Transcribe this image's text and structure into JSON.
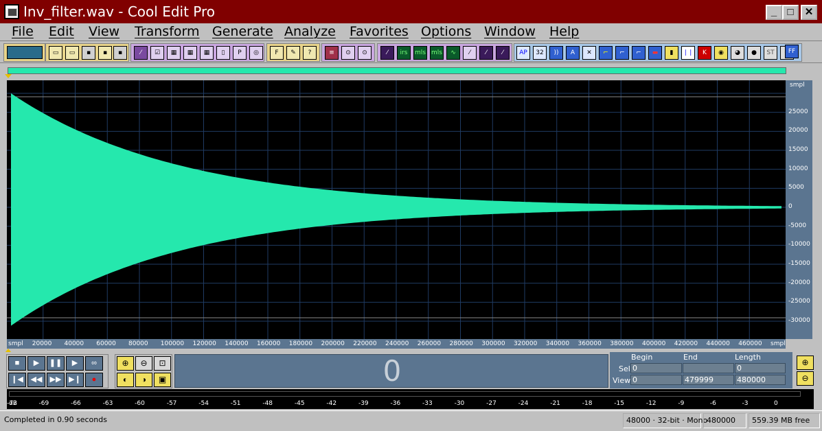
{
  "window": {
    "title": "Inv_filter.wav - Cool Edit Pro",
    "minimize": "_",
    "maximize": "□",
    "close": "✕"
  },
  "menu": [
    "File",
    "Edit",
    "View",
    "Transform",
    "Generate",
    "Analyze",
    "Favorites",
    "Options",
    "Window",
    "Help"
  ],
  "toolbar": {
    "cd_label": "F",
    "help_label": "?",
    "labels": [
      "irs",
      "mls",
      "mls",
      "AP",
      "32",
      "ST"
    ]
  },
  "waveform": {
    "fill_color": "#25e8ad",
    "background": "#000000",
    "grid_color": "#1f3b63",
    "sample_rate": 48000,
    "length_samples": 480000,
    "peak_amplitude": 30000
  },
  "ruler_y": {
    "unit": "smpl",
    "ticks": [
      "25000",
      "20000",
      "15000",
      "10000",
      "5000",
      "0",
      "-5000",
      "-10000",
      "-15000",
      "-20000",
      "-25000",
      "-30000"
    ]
  },
  "ruler_x": {
    "unit_left": "smpl",
    "unit_right": "smpl",
    "ticks": [
      "20000",
      "40000",
      "60000",
      "80000",
      "100000",
      "120000",
      "140000",
      "160000",
      "180000",
      "200000",
      "220000",
      "240000",
      "260000",
      "280000",
      "300000",
      "320000",
      "340000",
      "360000",
      "380000",
      "400000",
      "420000",
      "440000",
      "460000"
    ]
  },
  "transport": {
    "stop": "■",
    "play": "▶",
    "pause": "❚❚",
    "play_to_end": "▶",
    "loop": "∞",
    "go_start": "❙◀",
    "rewind": "◀◀",
    "forward": "▶▶",
    "go_end": "▶❙",
    "record": "●"
  },
  "zoom": {
    "in": "⊕",
    "out": "⊖",
    "full": "⊡",
    "left": "◐",
    "right": "◑",
    "sel": "▣",
    "vin": "⊕",
    "vout": "⊖"
  },
  "time_display": "0",
  "selection": {
    "headers": {
      "begin": "Begin",
      "end": "End",
      "length": "Length"
    },
    "rows": [
      {
        "label": "Sel",
        "begin": "0",
        "end": "",
        "length": "0"
      },
      {
        "label": "View",
        "begin": "0",
        "end": "479999",
        "length": "480000"
      }
    ]
  },
  "meter": {
    "unit": "dB",
    "ticks": [
      "-72",
      "-69",
      "-66",
      "-63",
      "-60",
      "-57",
      "-54",
      "-51",
      "-48",
      "-45",
      "-42",
      "-39",
      "-36",
      "-33",
      "-30",
      "-27",
      "-24",
      "-21",
      "-18",
      "-15",
      "-12",
      "-9",
      "-6",
      "-3",
      "0"
    ]
  },
  "status": {
    "message": "Completed in 0.90 seconds",
    "format": "48000 · 32-bit · Mono",
    "samples": "480000",
    "free_space": "559.39 MB free"
  }
}
